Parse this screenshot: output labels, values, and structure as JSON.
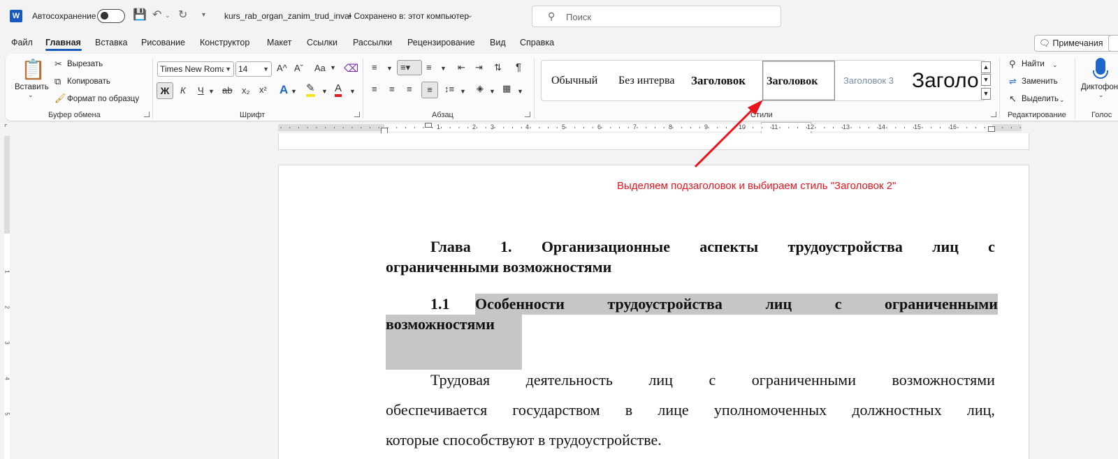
{
  "title_bar": {
    "autosave_label": "Автосохранение",
    "doc_title": "kurs_rab_organ_zanim_trud_inval",
    "save_status": "• Сохранено в: этот компьютер",
    "search_placeholder": "Поиск"
  },
  "menu": {
    "items": [
      "Файл",
      "Главная",
      "Вставка",
      "Рисование",
      "Конструктор",
      "Макет",
      "Ссылки",
      "Рассылки",
      "Рецензирование",
      "Вид",
      "Справка"
    ],
    "active": "Главная",
    "comments_label": "Примечания"
  },
  "ribbon": {
    "clipboard": {
      "paste": "Вставить",
      "cut": "Вырезать",
      "copy": "Копировать",
      "format_painter": "Формат по образцу",
      "label": "Буфер обмена"
    },
    "font": {
      "font_name": "Times New Roman",
      "font_size": "14",
      "label": "Шрифт",
      "bold": "Ж",
      "italic": "К",
      "underline": "Ч",
      "strike": "ab",
      "subscript": "x₂",
      "superscript": "x²",
      "grow": "A^",
      "shrink": "Aˇ",
      "case": "Aa",
      "text_effects": "A",
      "font_color": "A"
    },
    "paragraph": {
      "label": "Абзац",
      "pilcrow": "¶"
    },
    "styles": {
      "items": [
        "Обычный",
        "Без интерва",
        "Заголовок",
        "Заголовок",
        "Заголовок 3",
        "Заголо"
      ],
      "label": "Стили",
      "tooltip": "Заголовок 2"
    },
    "editing": {
      "find": "Найти",
      "replace": "Заменить",
      "select": "Выделить",
      "label": "Редактирование"
    },
    "voice": {
      "dictate": "Диктофон",
      "label": "Голос"
    }
  },
  "ruler": {
    "numbers": [
      "1",
      "2",
      "3",
      "4",
      "5",
      "6",
      "7",
      "8",
      "9",
      "10",
      "11",
      "12",
      "13",
      "14",
      "15",
      "16"
    ],
    "vertical_numbers": [
      "1",
      "2",
      "3",
      "4",
      "5"
    ]
  },
  "annotation": "Выделяем подзаголовок и выбираем стиль \"Заголовок 2\"",
  "document": {
    "heading1_line1": [
      "Глава",
      "1.",
      "Организационные",
      "аспекты",
      "трудоустройства",
      "лиц",
      "с"
    ],
    "heading1_line2": "ограниченными возможностями",
    "heading2_number": "1.1",
    "heading2_line1": [
      "Особенности",
      "трудоустройства",
      "лиц",
      "с",
      "ограниченными"
    ],
    "heading2_line2": "возможностями",
    "body_line1": [
      "Трудовая",
      "деятельность",
      "лиц",
      "с",
      "ограниченными",
      "возможностями"
    ],
    "body_line2": [
      "обеспечивается",
      "государством",
      "в",
      "лице",
      "уполномоченных",
      "должностных",
      "лиц,"
    ],
    "body_line3": "которые способствуют в трудоустройстве."
  },
  "colors": {
    "accent": "#185abd",
    "annotation": "#e8141c",
    "highlight": "#c6c6c6"
  }
}
